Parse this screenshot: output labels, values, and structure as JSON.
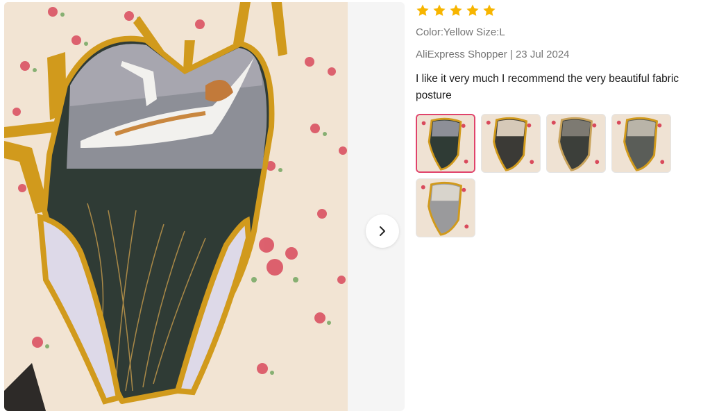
{
  "review": {
    "rating": 5,
    "rating_color": "#f7b500",
    "sku": "Color:Yellow Size:L",
    "author_date": "AliExpress Shopper | 23 Jul 2024",
    "text": "I like it very much I recommend the very beautiful fabric posture",
    "thumbnails": [
      {
        "label": "photo-1",
        "active": true
      },
      {
        "label": "photo-2",
        "active": false
      },
      {
        "label": "photo-3",
        "active": false
      },
      {
        "label": "photo-4",
        "active": false
      },
      {
        "label": "photo-5",
        "active": false
      }
    ]
  },
  "gallery": {
    "next_icon": "chevron-right-icon",
    "accent_trim": "#d19a1c",
    "active_thumb_border": "#e0436b"
  }
}
